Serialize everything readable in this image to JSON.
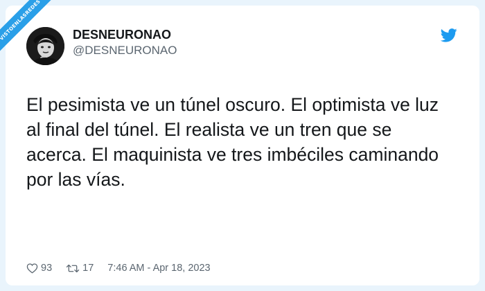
{
  "watermark": {
    "text": "VISTOENLASREDES"
  },
  "tweet": {
    "author": {
      "name": "DESNEURONAO",
      "handle": "@DESNEURONAO"
    },
    "text": "El pesimista ve un túnel oscuro. El optimista ve luz al final del túnel. El realista ve un tren que se acerca. El maquinista ve tres imbéciles caminando por las vías.",
    "likes": "93",
    "retweets": "17",
    "timestamp": "7:46 AM - Apr 18, 2023"
  },
  "icons": {
    "brand": "twitter-bird-icon",
    "like": "heart-icon",
    "retweet": "retweet-icon"
  },
  "colors": {
    "brand_blue": "#1d9bf0",
    "text": "#14171a",
    "muted": "#5b6670",
    "watermark_blue": "#2a9fe8",
    "background": "#e9f4fc"
  }
}
